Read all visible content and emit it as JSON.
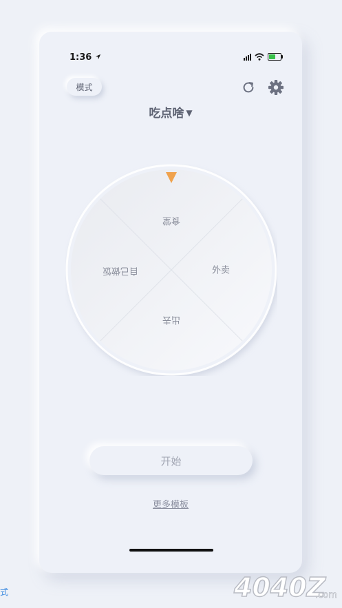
{
  "status_bar": {
    "time": "1:36",
    "location_icon": "location-arrow-icon",
    "signal_icon": "cellular-signal-icon",
    "wifi_icon": "wifi-icon",
    "battery_icon": "battery-charging-icon"
  },
  "header": {
    "mode_label": "模式",
    "title": "吃点啥",
    "title_caret": "▼",
    "refresh_icon": "refresh-icon",
    "settings_icon": "gear-icon"
  },
  "wheel": {
    "pointer_color": "#f0a24d",
    "segments": [
      {
        "label": "食堂"
      },
      {
        "label": "外卖"
      },
      {
        "label": "出去"
      },
      {
        "label": "自己做饭"
      }
    ]
  },
  "actions": {
    "start_label": "开始",
    "more_templates_label": "更多模板"
  },
  "background": {
    "corner_text": "式",
    "watermark_text": "4040Z.com"
  }
}
